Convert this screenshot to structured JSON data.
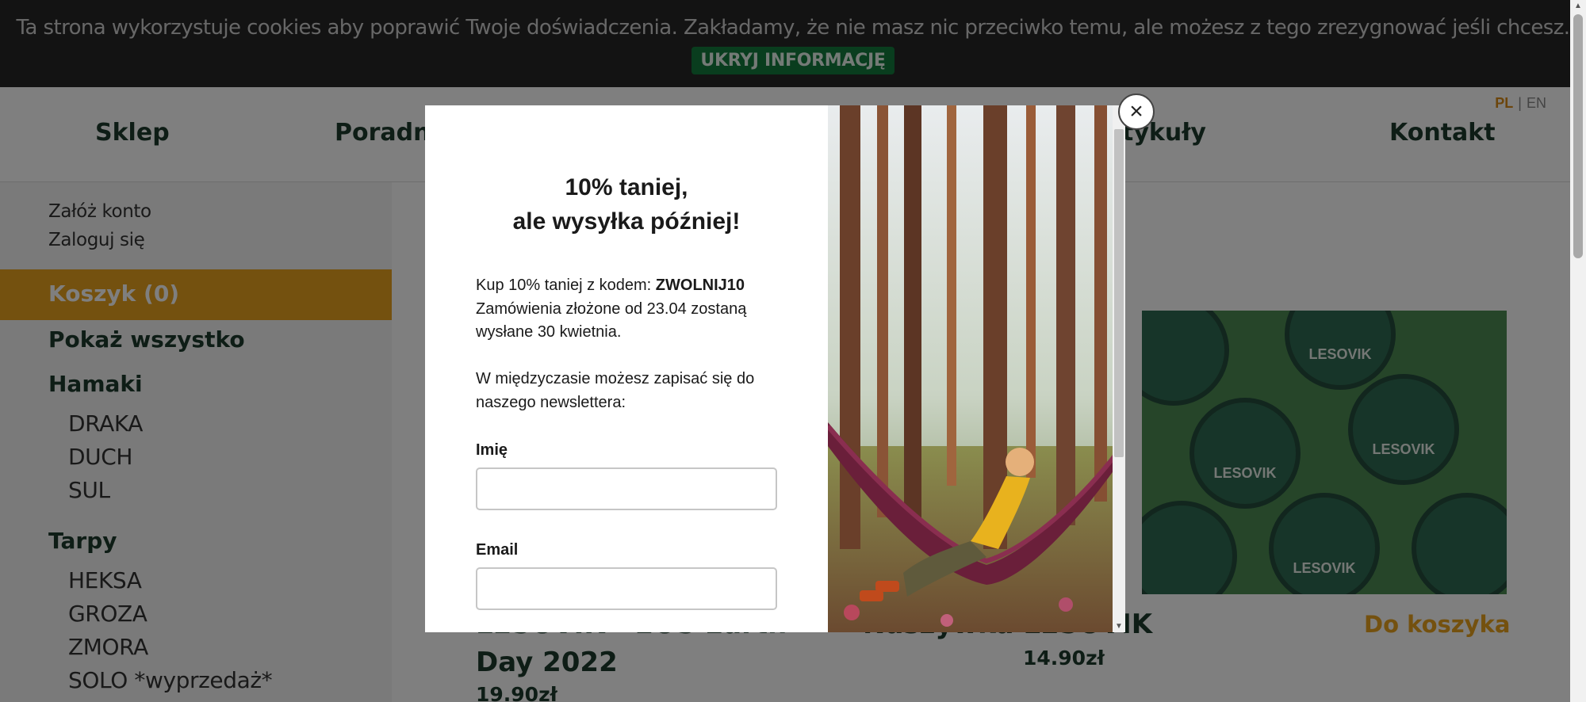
{
  "cookie": {
    "text": "Ta strona wykorzystuje cookies aby poprawić Twoje doświadczenia. Zakładamy, że nie masz nic przeciwko temu, ale możesz z tego zrezygnować jeśli chcesz.",
    "button": "UKRYJ INFORMACJĘ"
  },
  "nav": {
    "items": [
      "Sklep",
      "Poradnik",
      "Artykuły",
      "Kontakt"
    ],
    "lang_pl": "PL",
    "lang_sep": "|",
    "lang_en": "EN"
  },
  "sidebar": {
    "create_account": "Załóż konto",
    "login": "Zaloguj się",
    "cart": "Koszyk (0)",
    "show_all": "Pokaż wszystko",
    "categories": [
      {
        "name": "Hamaki",
        "items": [
          "DRAKA",
          "DUCH",
          "SUL"
        ]
      },
      {
        "name": "Tarpy",
        "items": [
          "HEKSA",
          "GROZA",
          "ZMORA",
          "SOLO *wyprzedaż*"
        ]
      }
    ]
  },
  "products": [
    {
      "title_line1": "LESOVIK - EOS Earth",
      "title_line2": "Day 2022",
      "price": "19.90zł"
    },
    {
      "title": "Naszywka LESOVIK",
      "price": "14.90zł",
      "add_to_cart": "Do koszyka",
      "patch_text": "LESOVIK"
    }
  ],
  "modal": {
    "title_line1": "10% taniej,",
    "title_line2": "ale wysyłka później!",
    "code_prefix": "Kup 10% taniej z kodem: ",
    "code": "ZWOLNIJ10",
    "info_line1": "Zamówienia złożone od 23.04 zostaną",
    "info_line2": "wysłane 30 kwietnia.",
    "newsletter_line1": "W międzyczasie możesz zapisać się do",
    "newsletter_line2": "naszego newslettera:",
    "name_label": "Imię",
    "email_label": "Email",
    "name_value": "",
    "email_value": "",
    "close_label": "×"
  },
  "colors": {
    "accent": "#e8a21e",
    "brand_green": "#1c3a2c",
    "cookie_button": "#137a3c",
    "cookie_bg": "#262626"
  }
}
